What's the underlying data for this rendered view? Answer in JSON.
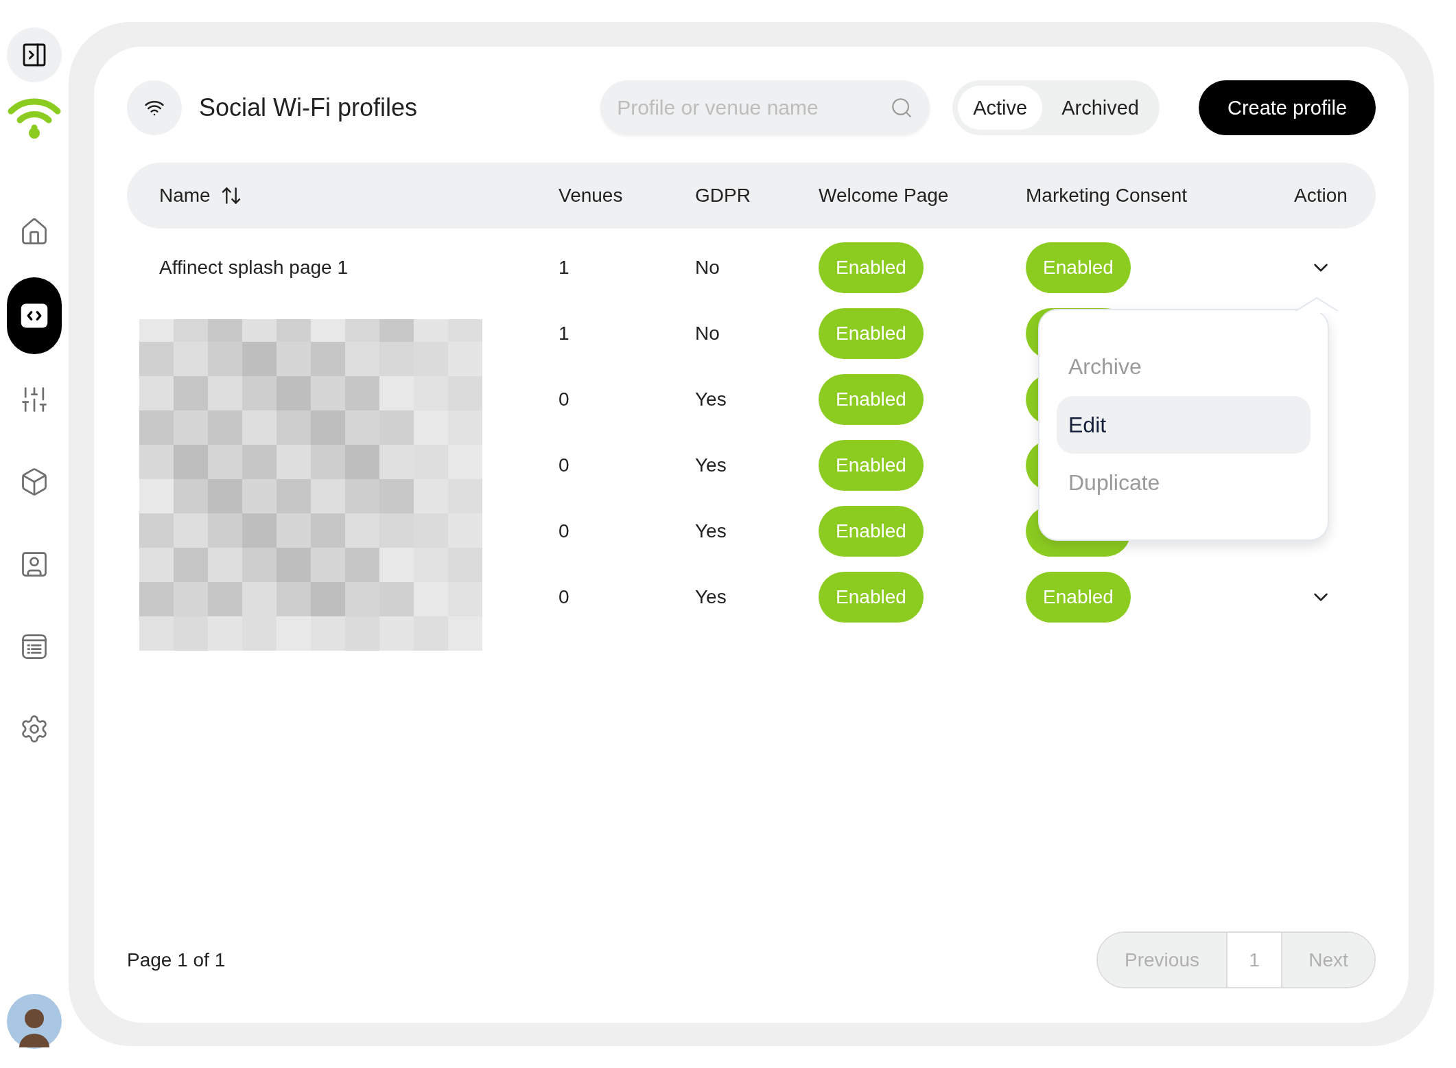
{
  "sidebar": {
    "items": [
      {
        "kind": "home",
        "selected": false
      },
      {
        "kind": "code",
        "selected": true
      },
      {
        "kind": "sliders",
        "selected": false
      },
      {
        "kind": "box",
        "selected": false
      },
      {
        "kind": "contact",
        "selected": false
      },
      {
        "kind": "list",
        "selected": false
      },
      {
        "kind": "settings",
        "selected": false
      }
    ]
  },
  "header": {
    "title": "Social Wi-Fi profiles",
    "search": {
      "placeholder": "Profile or venue name"
    },
    "filters": [
      {
        "label": "Active",
        "selected": true
      },
      {
        "label": "Archived",
        "selected": false
      }
    ],
    "create_button": "Create profile"
  },
  "table": {
    "columns": [
      "Name",
      "Venues",
      "GDPR",
      "Welcome Page",
      "Marketing Consent",
      "Action"
    ],
    "rows": [
      {
        "name": "Affinect splash page 1",
        "venues": "1",
        "gdpr": "No",
        "welcome_page": "Enabled",
        "marketing_consent": "Enabled",
        "marketing_pill": true,
        "chevron": true
      },
      {
        "venues": "1",
        "gdpr": "No",
        "welcome_page": "Enabled",
        "marketing_pill": true,
        "chevron": false
      },
      {
        "venues": "0",
        "gdpr": "Yes",
        "welcome_page": "Enabled",
        "marketing_pill": true,
        "chevron": false
      },
      {
        "venues": "0",
        "gdpr": "Yes",
        "welcome_page": "Enabled",
        "marketing_pill": true,
        "chevron": false
      },
      {
        "venues": "0",
        "gdpr": "Yes",
        "welcome_page": "Enabled",
        "marketing_pill": true,
        "chevron": false
      },
      {
        "venues": "0",
        "gdpr": "Yes",
        "welcome_page": "Enabled",
        "marketing_consent": "Enabled",
        "marketing_pill": true,
        "chevron": true
      }
    ]
  },
  "action_menu": {
    "items": [
      {
        "label": "Archive",
        "selected": false
      },
      {
        "label": "Edit",
        "selected": true
      },
      {
        "label": "Duplicate",
        "selected": false
      }
    ]
  },
  "pagination": {
    "summary": "Page 1 of 1",
    "previous": {
      "label": "Previous",
      "disabled": true
    },
    "pages": [
      {
        "label": "1",
        "selected": true
      }
    ],
    "next": {
      "label": "Next",
      "disabled": true
    }
  }
}
